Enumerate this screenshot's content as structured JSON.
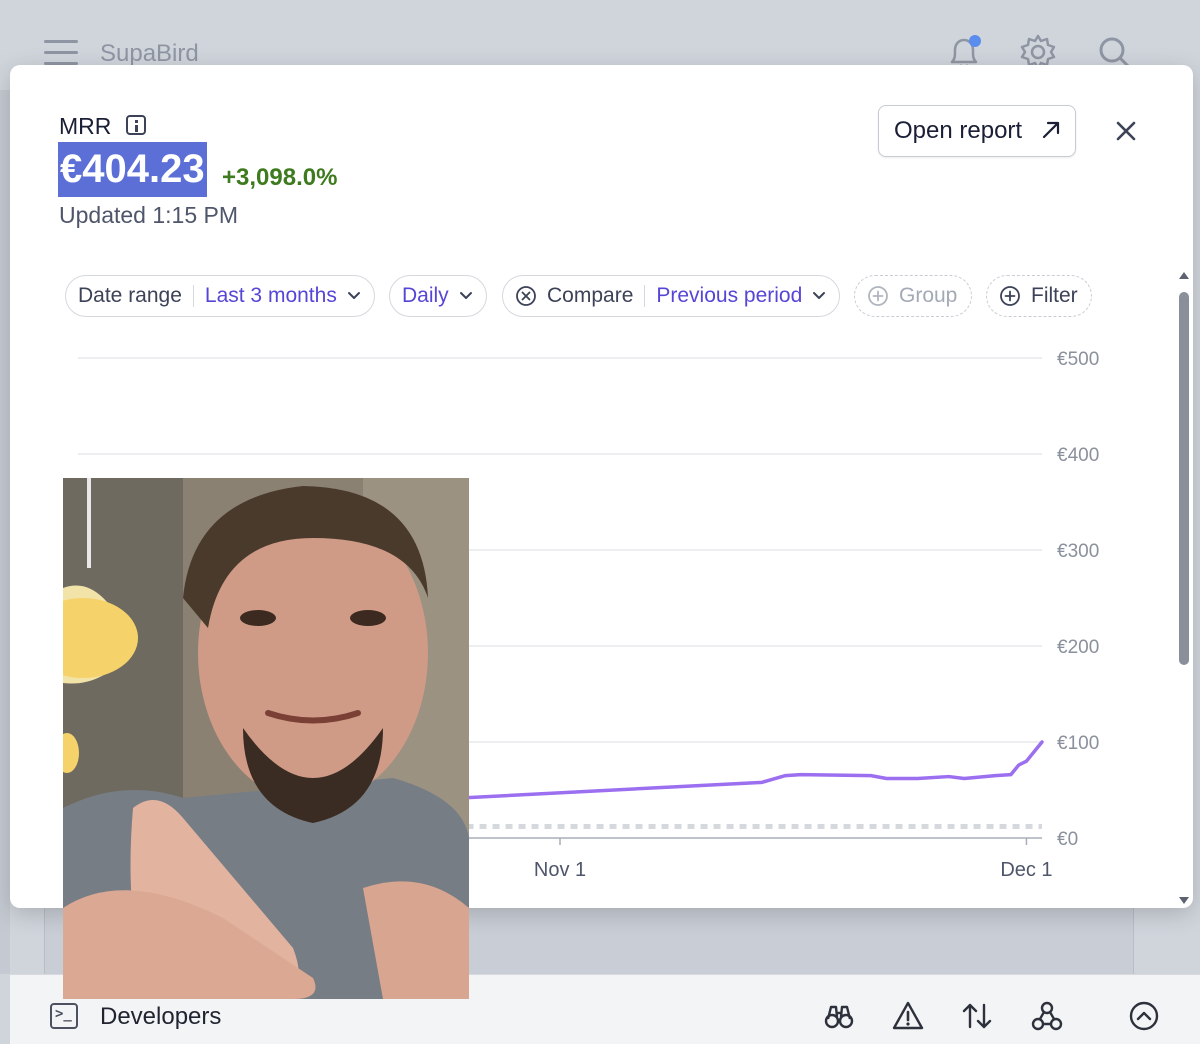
{
  "app": {
    "title": "SupaBird"
  },
  "modal": {
    "metric_label": "MRR",
    "value": "€404.23",
    "change": "+3,098.0%",
    "updated": "Updated 1:15 PM",
    "open_report_label": "Open report"
  },
  "filters": {
    "date_range": {
      "label": "Date range",
      "value": "Last 3 months"
    },
    "interval": {
      "value": "Daily"
    },
    "compare": {
      "label": "Compare",
      "value": "Previous period"
    },
    "group": {
      "label": "Group"
    },
    "filter": {
      "label": "Filter"
    }
  },
  "footer": {
    "developers_label": "Developers"
  },
  "colors": {
    "accent": "#5646d6",
    "series": "#9b6ff0",
    "positive": "#3e7a1e",
    "highlight": "#5b6fd6"
  },
  "chart_data": {
    "type": "line",
    "y_ticks": [
      "€0",
      "€100",
      "€200",
      "€300",
      "€400",
      "€500"
    ],
    "y_values": [
      0,
      100,
      200,
      300,
      400,
      500
    ],
    "ylim": [
      0,
      500
    ],
    "x_ticks": [
      "Nov 1",
      "Dec 1"
    ],
    "x_tick_days": [
      31,
      61
    ],
    "xlim": [
      0,
      62
    ],
    "grid": true,
    "series": [
      {
        "style": "solid",
        "color": "#9b6ff0",
        "x": [
          0,
          19,
          44,
          45.5,
          46.5,
          51,
          52,
          53,
          54,
          56,
          57,
          59,
          60,
          60.5,
          61,
          62
        ],
        "values": [
          37,
          37,
          58,
          65,
          66,
          65,
          62,
          62,
          62,
          64,
          62,
          65,
          66,
          76,
          80,
          100
        ]
      },
      {
        "style": "dotted",
        "color": "#d5d8dd",
        "x": [
          0,
          20,
          21,
          24,
          25,
          62
        ],
        "values": [
          12,
          12,
          17,
          17,
          12,
          12
        ]
      }
    ]
  }
}
